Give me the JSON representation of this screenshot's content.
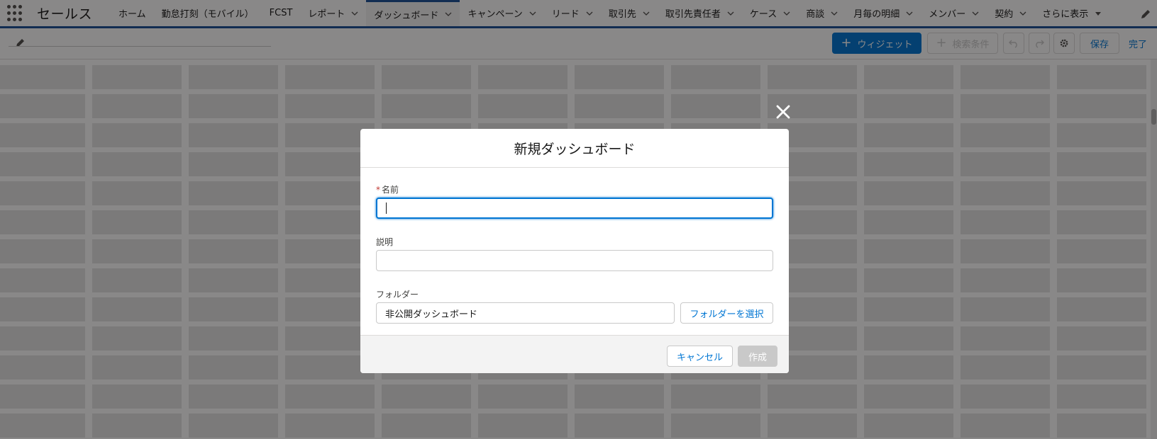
{
  "app": {
    "name": "セールス",
    "launcher_icon": "app-launcher-waffle-icon"
  },
  "nav": {
    "items": [
      {
        "label": "ホーム",
        "has_menu": false
      },
      {
        "label": "勤怠打刻（モバイル）",
        "has_menu": false
      },
      {
        "label": "FCST",
        "has_menu": false
      },
      {
        "label": "レポート",
        "has_menu": true
      },
      {
        "label": "ダッシュボード",
        "has_menu": true,
        "active": true
      },
      {
        "label": "キャンペーン",
        "has_menu": true
      },
      {
        "label": "リード",
        "has_menu": true
      },
      {
        "label": "取引先",
        "has_menu": true
      },
      {
        "label": "取引先責任者",
        "has_menu": true
      },
      {
        "label": "ケース",
        "has_menu": true
      },
      {
        "label": "商談",
        "has_menu": true
      },
      {
        "label": "月毎の明細",
        "has_menu": true
      },
      {
        "label": "メンバー",
        "has_menu": true
      },
      {
        "label": "契約",
        "has_menu": true
      },
      {
        "label": "さらに表示",
        "has_menu": true
      }
    ]
  },
  "toolbar": {
    "widget_label": "ウィジェット",
    "filter_label": "検索条件",
    "save_label": "保存",
    "done_label": "完了"
  },
  "modal": {
    "title": "新規ダッシュボード",
    "name_label": "名前",
    "name_required_mark": "*",
    "name_value": "",
    "description_label": "説明",
    "description_value": "",
    "folder_label": "フォルダー",
    "folder_value": "非公開ダッシュボード",
    "folder_select_label": "フォルダーを選択",
    "cancel_label": "キャンセル",
    "create_label": "作成"
  },
  "colors": {
    "brand": "#0176d3",
    "nav_border": "#1b5297",
    "required": "#c23934",
    "disabled": "#c9c9c9"
  }
}
